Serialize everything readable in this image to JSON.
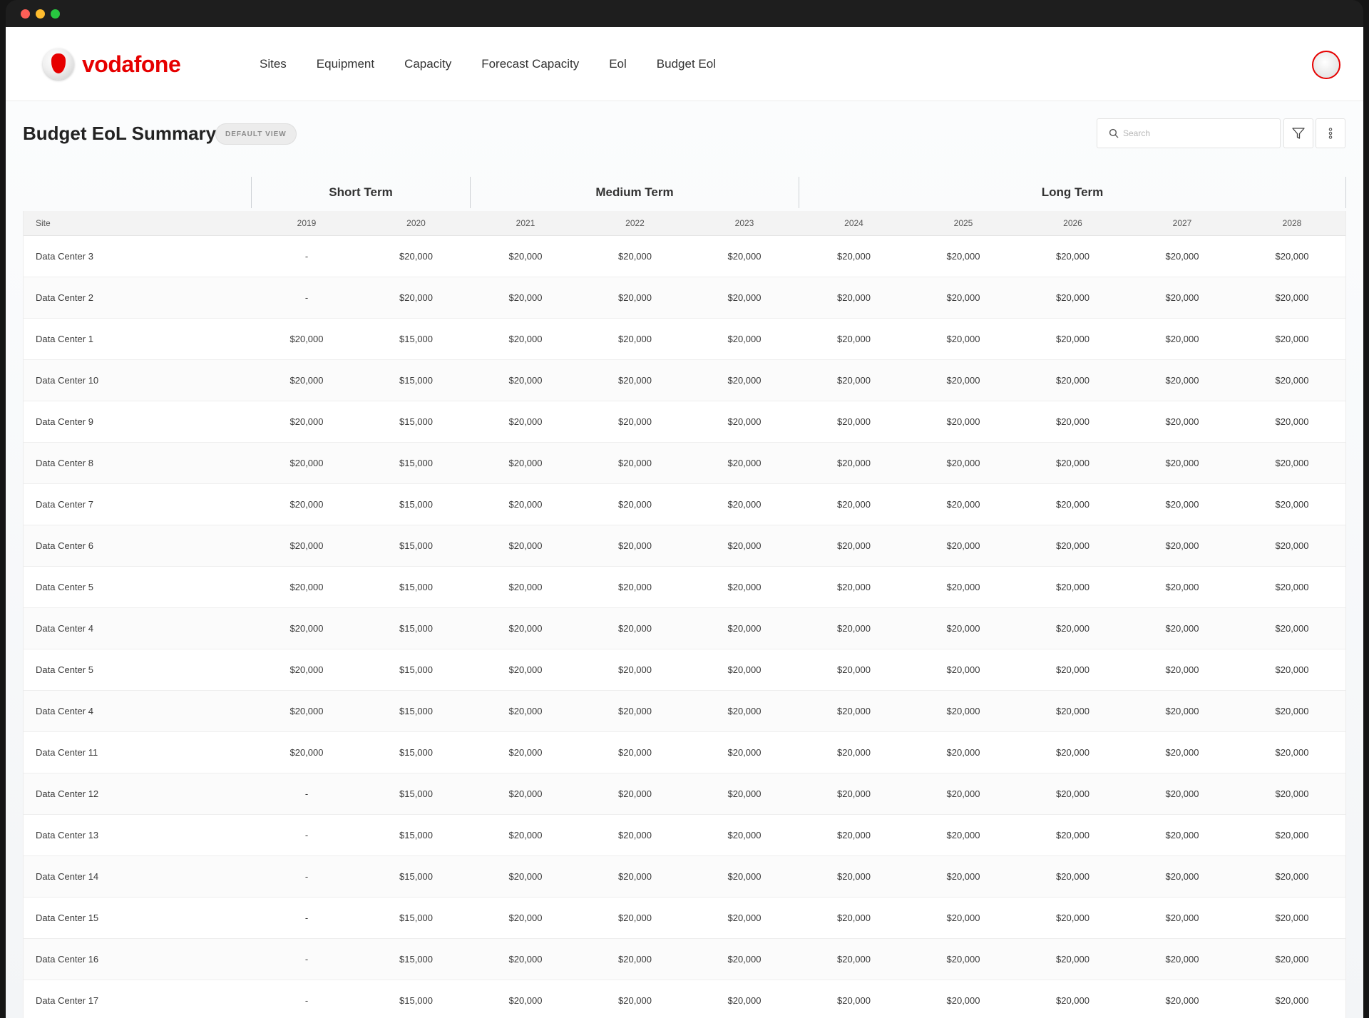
{
  "nav": {
    "logo_text": "vodafone",
    "items": [
      "Sites",
      "Equipment",
      "Capacity",
      "Forecast Capacity",
      "Eol",
      "Budget Eol"
    ]
  },
  "page": {
    "title": "Budget EoL Summary",
    "view_badge": "DEFAULT VIEW",
    "search_placeholder": "Search"
  },
  "groups": {
    "short": "Short Term",
    "medium": "Medium Term",
    "long": "Long Term"
  },
  "table": {
    "headers": [
      "Site",
      "2019",
      "2020",
      "2021",
      "2022",
      "2023",
      "2024",
      "2025",
      "2026",
      "2027",
      "2028"
    ],
    "rows": [
      [
        "Data Center 3",
        "-",
        "$20,000",
        "$20,000",
        "$20,000",
        "$20,000",
        "$20,000",
        "$20,000",
        "$20,000",
        "$20,000",
        "$20,000"
      ],
      [
        "Data Center 2",
        "-",
        "$20,000",
        "$20,000",
        "$20,000",
        "$20,000",
        "$20,000",
        "$20,000",
        "$20,000",
        "$20,000",
        "$20,000"
      ],
      [
        "Data Center 1",
        "$20,000",
        "$15,000",
        "$20,000",
        "$20,000",
        "$20,000",
        "$20,000",
        "$20,000",
        "$20,000",
        "$20,000",
        "$20,000"
      ],
      [
        "Data Center 10",
        "$20,000",
        "$15,000",
        "$20,000",
        "$20,000",
        "$20,000",
        "$20,000",
        "$20,000",
        "$20,000",
        "$20,000",
        "$20,000"
      ],
      [
        "Data Center 9",
        "$20,000",
        "$15,000",
        "$20,000",
        "$20,000",
        "$20,000",
        "$20,000",
        "$20,000",
        "$20,000",
        "$20,000",
        "$20,000"
      ],
      [
        "Data Center 8",
        "$20,000",
        "$15,000",
        "$20,000",
        "$20,000",
        "$20,000",
        "$20,000",
        "$20,000",
        "$20,000",
        "$20,000",
        "$20,000"
      ],
      [
        "Data Center 7",
        "$20,000",
        "$15,000",
        "$20,000",
        "$20,000",
        "$20,000",
        "$20,000",
        "$20,000",
        "$20,000",
        "$20,000",
        "$20,000"
      ],
      [
        "Data Center 6",
        "$20,000",
        "$15,000",
        "$20,000",
        "$20,000",
        "$20,000",
        "$20,000",
        "$20,000",
        "$20,000",
        "$20,000",
        "$20,000"
      ],
      [
        "Data Center 5",
        "$20,000",
        "$15,000",
        "$20,000",
        "$20,000",
        "$20,000",
        "$20,000",
        "$20,000",
        "$20,000",
        "$20,000",
        "$20,000"
      ],
      [
        "Data Center 4",
        "$20,000",
        "$15,000",
        "$20,000",
        "$20,000",
        "$20,000",
        "$20,000",
        "$20,000",
        "$20,000",
        "$20,000",
        "$20,000"
      ],
      [
        "Data Center 5",
        "$20,000",
        "$15,000",
        "$20,000",
        "$20,000",
        "$20,000",
        "$20,000",
        "$20,000",
        "$20,000",
        "$20,000",
        "$20,000"
      ],
      [
        "Data Center 4",
        "$20,000",
        "$15,000",
        "$20,000",
        "$20,000",
        "$20,000",
        "$20,000",
        "$20,000",
        "$20,000",
        "$20,000",
        "$20,000"
      ],
      [
        "Data Center 11",
        "$20,000",
        "$15,000",
        "$20,000",
        "$20,000",
        "$20,000",
        "$20,000",
        "$20,000",
        "$20,000",
        "$20,000",
        "$20,000"
      ],
      [
        "Data Center 12",
        "-",
        "$15,000",
        "$20,000",
        "$20,000",
        "$20,000",
        "$20,000",
        "$20,000",
        "$20,000",
        "$20,000",
        "$20,000"
      ],
      [
        "Data Center 13",
        "-",
        "$15,000",
        "$20,000",
        "$20,000",
        "$20,000",
        "$20,000",
        "$20,000",
        "$20,000",
        "$20,000",
        "$20,000"
      ],
      [
        "Data Center 14",
        "-",
        "$15,000",
        "$20,000",
        "$20,000",
        "$20,000",
        "$20,000",
        "$20,000",
        "$20,000",
        "$20,000",
        "$20,000"
      ],
      [
        "Data Center 15",
        "-",
        "$15,000",
        "$20,000",
        "$20,000",
        "$20,000",
        "$20,000",
        "$20,000",
        "$20,000",
        "$20,000",
        "$20,000"
      ],
      [
        "Data Center 16",
        "-",
        "$15,000",
        "$20,000",
        "$20,000",
        "$20,000",
        "$20,000",
        "$20,000",
        "$20,000",
        "$20,000",
        "$20,000"
      ],
      [
        "Data Center 17",
        "-",
        "$15,000",
        "$20,000",
        "$20,000",
        "$20,000",
        "$20,000",
        "$20,000",
        "$20,000",
        "$20,000",
        "$20,000"
      ]
    ]
  },
  "colors": {
    "brand": "#e60000"
  },
  "icons": {
    "search": "search-icon",
    "filter": "filter-icon",
    "more": "more-vertical-icon"
  }
}
